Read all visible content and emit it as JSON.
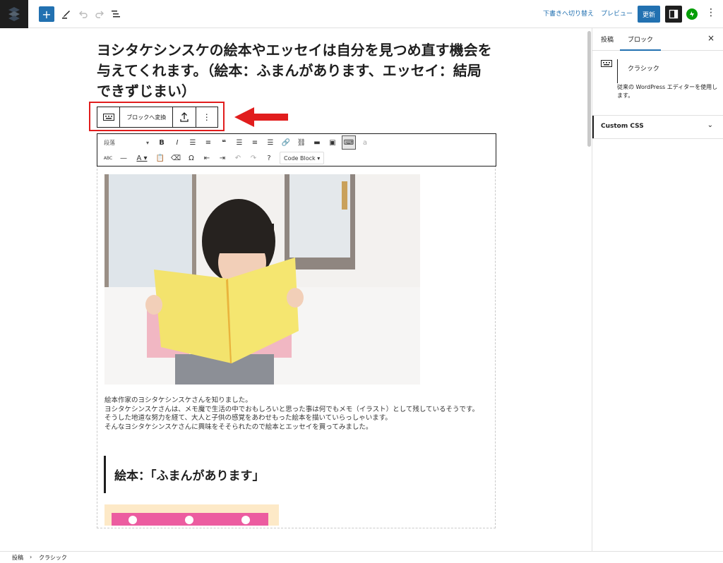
{
  "topbar": {
    "inserter_label": "+",
    "switch_draft": "下書きへ切り替え",
    "preview": "プレビュー",
    "update": "更新",
    "more": "⋮"
  },
  "sidebar": {
    "tabs": [
      {
        "label": "投稿"
      },
      {
        "label": "ブロック"
      }
    ],
    "close": "×",
    "block": {
      "name": "クラシック",
      "description": "従来の WordPress エディターを使用します。"
    },
    "panels": [
      {
        "label": "Custom CSS",
        "chevron": "⌄"
      }
    ]
  },
  "post": {
    "title": "ヨシタケシンスケの絵本やエッセイは自分を見つめ直す機会を与えてくれます。（絵本：ふまんがあります、エッセイ：結局できずじまい）",
    "paragraphs": [
      "絵本作家のヨシタケシンスケさんを知りました。",
      "ヨシタケシンスケさんは、メモ魔で生活の中でおもしろいと思った事は何でもメモ（イラスト）として残しているそうです。",
      "そうした地道な努力を経て、大人と子供の感覚をあわせもった絵本を描いていらっしゃいます。",
      "そんなヨシタケシンスケさんに興味をそそられたので絵本とエッセイを買ってみました。"
    ],
    "heading": "絵本：「ふまんがあります」"
  },
  "block_toolbar": {
    "convert": "ブロックへ変換",
    "more": "⋮"
  },
  "classic_toolbar": {
    "format_select": "段落",
    "code_block": "Code Block"
  },
  "breadcrumb": [
    "投稿",
    "クラシック"
  ],
  "colors": {
    "accent": "#2271b1",
    "highlight": "#e11d1d",
    "jetpack": "#069e08"
  }
}
